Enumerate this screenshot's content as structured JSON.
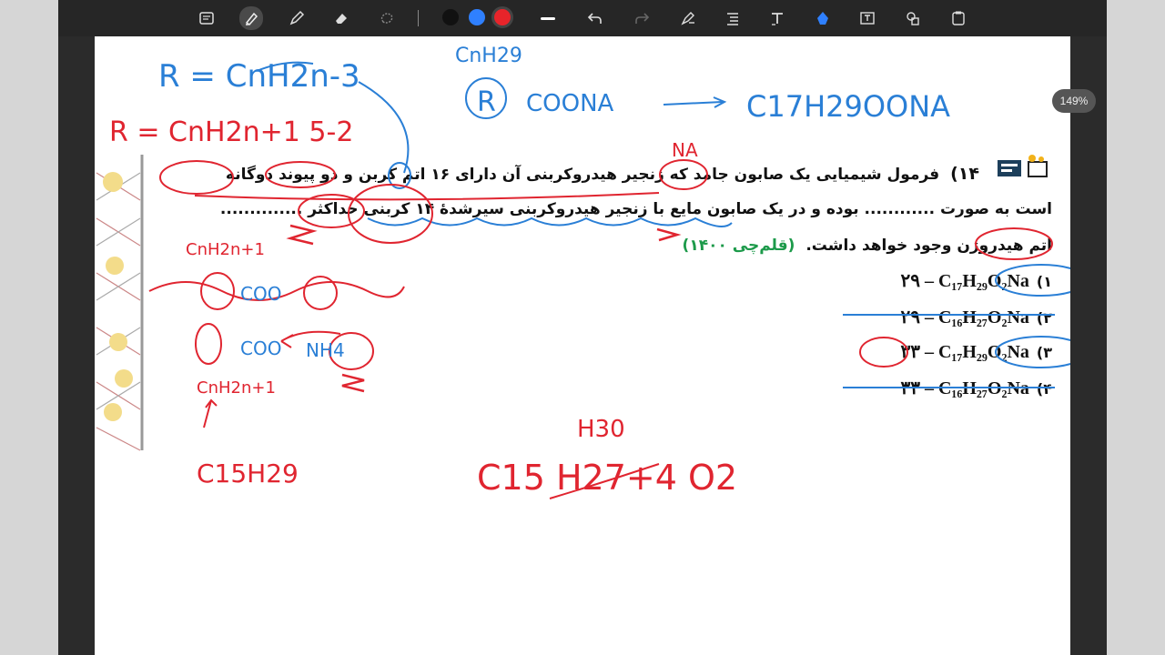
{
  "app": {
    "zoom_label": "149%"
  },
  "toolbar": {
    "tools": [
      "page-view-icon",
      "highlighter-icon",
      "pen-icon",
      "eraser-icon",
      "lasso-icon",
      "line-width-icon",
      "undo-icon",
      "redo-icon",
      "ruler-pen-icon",
      "text-list-icon",
      "text-icon",
      "shape-fill-icon",
      "text-box-icon",
      "shapes-icon",
      "clipboard-icon"
    ],
    "colors": [
      "#111111",
      "#2f80ff",
      "#e8242a"
    ]
  },
  "question": {
    "number": "۱۴)",
    "line1": "فرمول شیمیایی یک صابون جامد که زنجیر هیدروکربنی آن دارای ۱۶ اتم کربن و دو پیوند دوگانه",
    "line2": "است به صورت ............ بوده و در یک صابون مایع با زنجیر هیدروکربنی سیرشدهٔ ۱۴ کربنی حداکثر ..............",
    "line3": "اتم هیدروژن وجود خواهد داشت.",
    "source": "(قلم‌چی ۱۴۰۰)"
  },
  "options": [
    {
      "num": "۱)",
      "text": "۲۹ – C₁₇H₂₉O₂Na"
    },
    {
      "num": "۲)",
      "text": "۲۹ – C₁₆H₂₇O₂Na"
    },
    {
      "num": "۳)",
      "text": "۳۳ – C₁₇H₂₉O₂Na"
    },
    {
      "num": "۴)",
      "text": "۳۳ – C₁₆H₂₇O₂Na"
    }
  ],
  "handwriting": {
    "blue_r_formula": "R = CnH2n-3",
    "blue_center": "CnH29",
    "blue_coona": "COONA",
    "blue_product": "C17H29OONA",
    "red_r_formula": "R = CnH2n+1  5-2",
    "red_na": "NA",
    "red_cn1": "CnH2n+1",
    "red_coo": "COO",
    "red_coo2": "COO",
    "red_nh": "NH4",
    "red_cn2": "CnH2n+1",
    "red_c15": "C15H29",
    "red_h": "H30",
    "red_formula": "C15 H27+4  O2"
  }
}
